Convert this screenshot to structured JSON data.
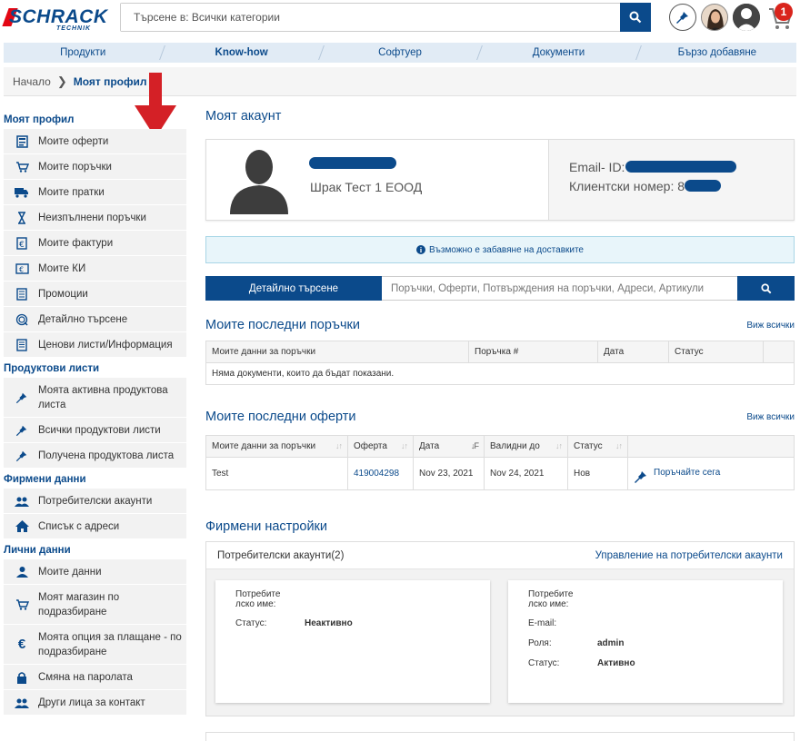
{
  "header": {
    "logo_text": "SCHRACK",
    "logo_sub": "TECHNIK",
    "search_placeholder": "Търсене в: Всички категории",
    "cart_count": "1",
    "icons": [
      "search-icon",
      "pin-icon",
      "user-avatar",
      "default-avatar",
      "cart-icon"
    ]
  },
  "nav": [
    "Продукти",
    "Know-how",
    "Софтуер",
    "Документи",
    "Бързо добавяне"
  ],
  "breadcrumb": {
    "home": "Начало",
    "current": "Моят профил"
  },
  "sidebar": {
    "sections": [
      {
        "title": "Моят профил",
        "items": [
          {
            "label": "Моите оферти",
            "icon": "offers-icon"
          },
          {
            "label": "Моите поръчки",
            "icon": "cart-icon"
          },
          {
            "label": "Моите пратки",
            "icon": "truck-icon"
          },
          {
            "label": "Неизпълнени поръчки",
            "icon": "hourglass-icon"
          },
          {
            "label": "Моите фактури",
            "icon": "invoice-icon"
          },
          {
            "label": "Моите КИ",
            "icon": "credit-note-icon"
          },
          {
            "label": "Промоции",
            "icon": "promo-icon"
          },
          {
            "label": "Детайлно търсене",
            "icon": "detail-search-icon"
          },
          {
            "label": "Ценови листи/Информация",
            "icon": "pricelist-icon"
          }
        ]
      },
      {
        "title": "Продуктови листи",
        "items": [
          {
            "label": "Моята активна продуктова листа",
            "icon": "pin-icon"
          },
          {
            "label": "Всички продуктови листи",
            "icon": "pin-icon"
          },
          {
            "label": "Получена продуктова листа",
            "icon": "pin-icon"
          }
        ]
      },
      {
        "title": "Фирмени данни",
        "items": [
          {
            "label": "Потребителски акаунти",
            "icon": "users-icon"
          },
          {
            "label": "Списък с адреси",
            "icon": "home-icon"
          }
        ]
      },
      {
        "title": "Лични данни",
        "items": [
          {
            "label": "Моите данни",
            "icon": "user-icon"
          },
          {
            "label": "Моят магазин по подразбиране",
            "icon": "shop-icon"
          },
          {
            "label": "Моята опция за плащане - по подразбиране",
            "icon": "euro-icon"
          },
          {
            "label": "Смяна на паролата",
            "icon": "lock-icon"
          },
          {
            "label": "Други лица за контакт",
            "icon": "users-icon"
          }
        ]
      }
    ]
  },
  "account": {
    "title": "Моят акаунт",
    "company": "Шрак Тест 1 ЕООД",
    "email_label": "Email- ID:",
    "customer_label": "Клиентски номер: 8"
  },
  "info_bar": "Възможно е забавяне на доставките",
  "adv_search": {
    "button": "Детайлно търсене",
    "placeholder": "Поръчки, Оферти, Потвърждения на поръчки, Адреси, Артикули"
  },
  "orders": {
    "title": "Моите последни поръчки",
    "see_all": "Виж всички",
    "columns": [
      "Моите данни за поръчки",
      "Поръчка #",
      "Дата",
      "Статус",
      ""
    ],
    "empty": "Няма документи, които да бъдат показани."
  },
  "offers": {
    "title": "Моите последни оферти",
    "see_all": "Виж всички",
    "columns": [
      "Моите данни за поръчки",
      "Оферта",
      "Дата",
      "Валидни до",
      "Статус",
      ""
    ],
    "rows": [
      {
        "data": "Test",
        "offer": "419004298",
        "date": "Nov 23, 2021",
        "valid": "Nov 24, 2021",
        "status": "Нов",
        "action": "Поръчайте сега"
      }
    ]
  },
  "company": {
    "title": "Фирмени настройки",
    "accounts_title": "Потребителски акаунти(2)",
    "manage_link": "Управление на потребителски акаунти",
    "cards": [
      {
        "username_label": "Потребите лско име:",
        "status_label": "Статус:",
        "status": "Неактивно"
      },
      {
        "username_label": "Потребите лско име:",
        "email_label": "E-mail:",
        "role_label": "Роля:",
        "role": "admin",
        "status_label": "Статус:",
        "status": "Активно"
      }
    ]
  },
  "colors": {
    "brand": "#0b4a8b",
    "badge": "#d9241c",
    "accent_red": "#e30613"
  }
}
